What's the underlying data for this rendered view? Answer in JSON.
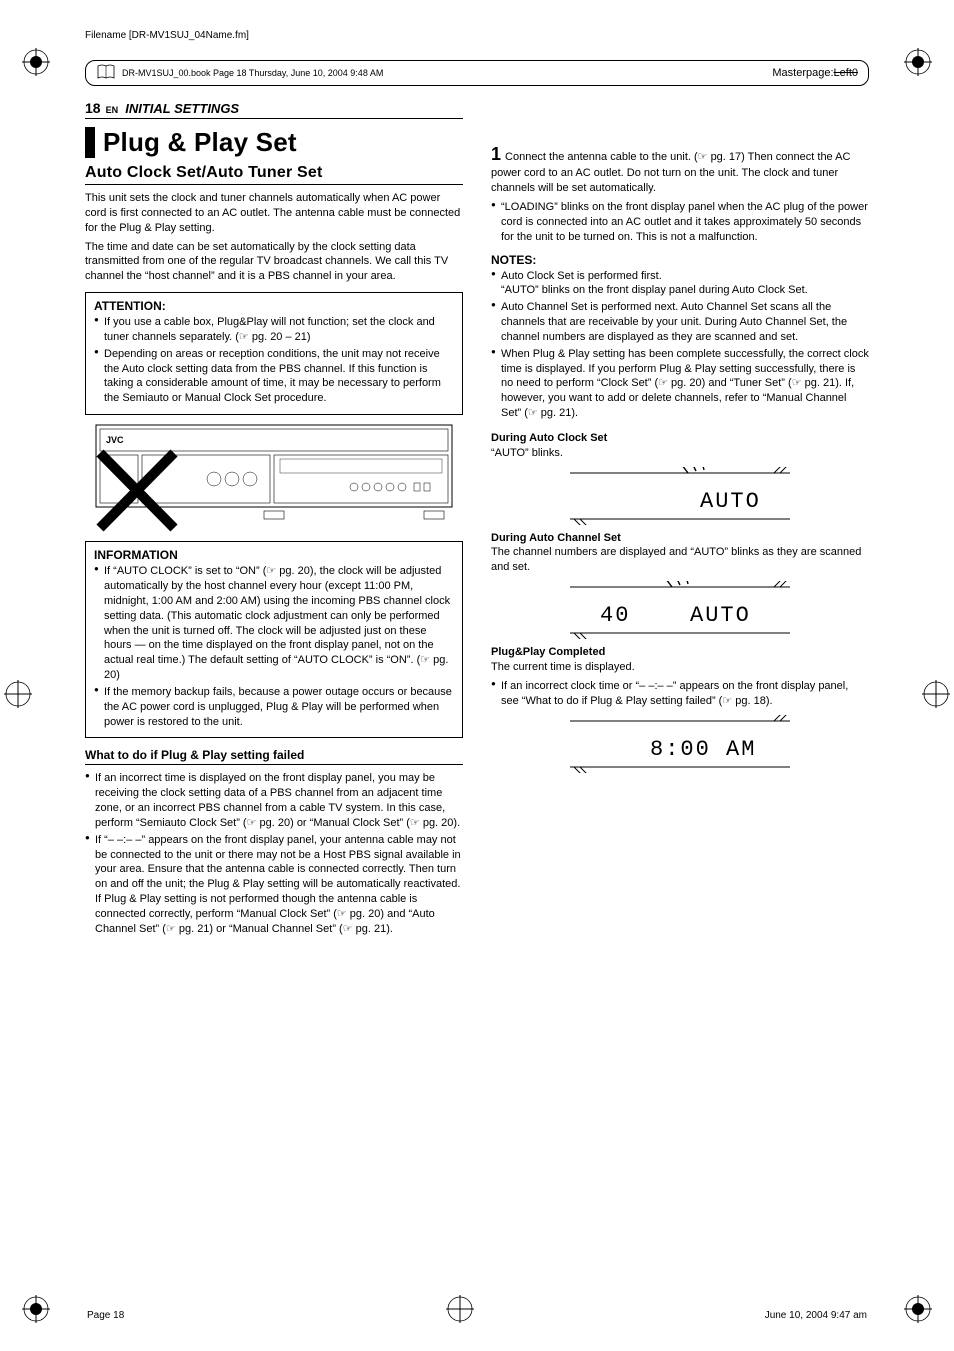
{
  "meta": {
    "filename_line": "Filename [DR-MV1SUJ_04Name.fm]",
    "book_line": "DR-MV1SUJ_00.book  Page 18  Thursday, June 10, 2004  9:48 AM",
    "masterpage": "Masterpage:",
    "masterpage_val": "Left0",
    "footer_page": "Page 18",
    "footer_date": "June 10, 2004 9:47 am"
  },
  "header": {
    "page_num": "18",
    "lang": "EN",
    "section": "INITIAL SETTINGS"
  },
  "left": {
    "title": "Plug & Play Set",
    "subtitle": "Auto Clock Set/Auto Tuner Set",
    "intro1": "This unit sets the clock and tuner channels automatically when AC power cord is first connected to an AC outlet. The antenna cable must be connected for the Plug & Play setting.",
    "intro2": "The time and date can be set automatically by the clock setting data transmitted from one of the regular TV broadcast channels. We call this TV channel the “host channel” and it is a PBS channel in your area.",
    "attention": {
      "title": "ATTENTION:",
      "items": [
        "If you use a cable box, Plug&Play will not function; set the clock and tuner channels separately. (☞ pg. 20 – 21)",
        "Depending on areas or reception conditions, the unit may not receive the Auto clock setting data from the PBS channel. If this function is taking a considerable amount of time, it may be necessary to perform the Semiauto or Manual Clock Set procedure."
      ]
    },
    "info": {
      "title": "INFORMATION",
      "items": [
        "If “AUTO CLOCK” is set to “ON” (☞ pg. 20), the clock will be adjusted automatically by the host channel every hour (except 11:00 PM, midnight, 1:00 AM and 2:00 AM) using the incoming PBS channel clock setting data. (This automatic clock adjustment can only be performed when the unit is turned off. The clock will be adjusted just on these hours — on the time displayed on the front display panel, not on the actual real time.) The default setting of “AUTO CLOCK” is “ON”. (☞ pg. 20)",
        "If the memory backup fails, because a power outage occurs or because the AC power cord is unplugged, Plug & Play will be performed when power is restored to the unit."
      ]
    },
    "fail": {
      "title": "What to do if Plug & Play setting failed",
      "items": [
        "If an incorrect time is displayed on the front display panel, you may be receiving the clock setting data of a PBS channel from an adjacent time zone, or an incorrect PBS channel from a cable TV system. In this case, perform “Semiauto Clock Set” (☞ pg. 20) or “Manual Clock Set” (☞ pg. 20).",
        "If “– –:– –” appears on the front display panel, your antenna cable may not be connected to the unit or there may not be a Host PBS signal available in your area. Ensure that the antenna cable is connected correctly. Then turn on and off the unit; the Plug & Play setting will be automatically reactivated. If Plug & Play setting is not performed though the antenna cable is connected correctly, perform “Manual Clock Set” (☞ pg. 20) and “Auto Channel Set” (☞ pg. 21) or “Manual Channel Set” (☞ pg. 21)."
      ]
    }
  },
  "right": {
    "step1_a": "Connect the antenna cable to the unit. (☞ pg. 17) Then connect the AC power cord to an AC outlet. Do not turn on the unit. The clock and tuner channels will be set automatically.",
    "step1_bullets": [
      "“LOADING” blinks on the front display panel when the AC plug of the power cord is connected into an AC outlet and it takes approximately 50 seconds for the unit to be turned on. This is not a malfunction."
    ],
    "notes_title": "NOTES:",
    "notes": [
      "Auto Clock Set is performed first.\n“AUTO” blinks on the front display panel during Auto Clock Set.",
      "Auto Channel Set is performed next. Auto Channel Set scans all the channels that are receivable by your unit. During Auto Channel Set, the channel numbers are displayed as they are scanned and set.",
      "When Plug & Play setting has been complete successfully, the correct clock time is displayed. If you perform Plug & Play setting successfully, there is no need to perform “Clock Set” (☞ pg. 20) and “Tuner Set” (☞ pg. 21). If, however, you want to add or delete channels, refer to “Manual Channel Set” (☞ pg. 21)."
    ],
    "during_clock_head": "During Auto Clock Set",
    "during_clock_text": "“AUTO” blinks.",
    "during_ch_head": "During Auto Channel Set",
    "during_ch_text": "The channel numbers are displayed and “AUTO” blinks as they are scanned and set.",
    "completed_head": "Plug&Play Completed",
    "completed_text": "The current time is displayed.",
    "completed_bullets": [
      "If an incorrect clock time or “– –:– –” appears on the front display panel, see “What to do if Plug & Play setting failed” (☞ pg. 18)."
    ],
    "panel1": "AUTO",
    "panel2_left": "40",
    "panel2_right": "AUTO",
    "panel3": "8:00 AM"
  }
}
